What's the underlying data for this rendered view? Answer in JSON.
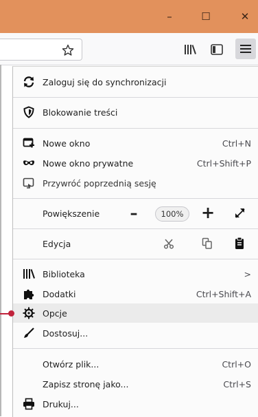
{
  "window_controls": {
    "minimize_label": "–",
    "maximize_label": "☐",
    "close_label": "✕"
  },
  "menu": {
    "sync": {
      "label": "Zaloguj się do synchronizacji"
    },
    "block": {
      "label": "Blokowanie treści"
    },
    "new_window": {
      "label": "Nowe okno",
      "shortcut": "Ctrl+N"
    },
    "new_private": {
      "label": "Nowe okno prywatne",
      "shortcut": "Ctrl+Shift+P"
    },
    "restore": {
      "label": "Przywróć poprzednią sesję"
    },
    "zoom": {
      "label": "Powiększenie",
      "minus": "–",
      "value": "100%",
      "plus": "+"
    },
    "edit": {
      "label": "Edycja"
    },
    "library": {
      "label": "Biblioteka",
      "arrow": ">"
    },
    "addons": {
      "label": "Dodatki",
      "shortcut": "Ctrl+Shift+A"
    },
    "options": {
      "label": "Opcje"
    },
    "customize": {
      "label": "Dostosuj..."
    },
    "open_file": {
      "label": "Otwórz plik...",
      "shortcut": "Ctrl+O"
    },
    "save_page": {
      "label": "Zapisz stronę jako...",
      "shortcut": "Ctrl+S"
    },
    "print": {
      "label": "Drukuj..."
    }
  },
  "colors": {
    "titlebar": "#e2915c",
    "callout": "#c0223b",
    "highlight": "#ebebeb"
  }
}
